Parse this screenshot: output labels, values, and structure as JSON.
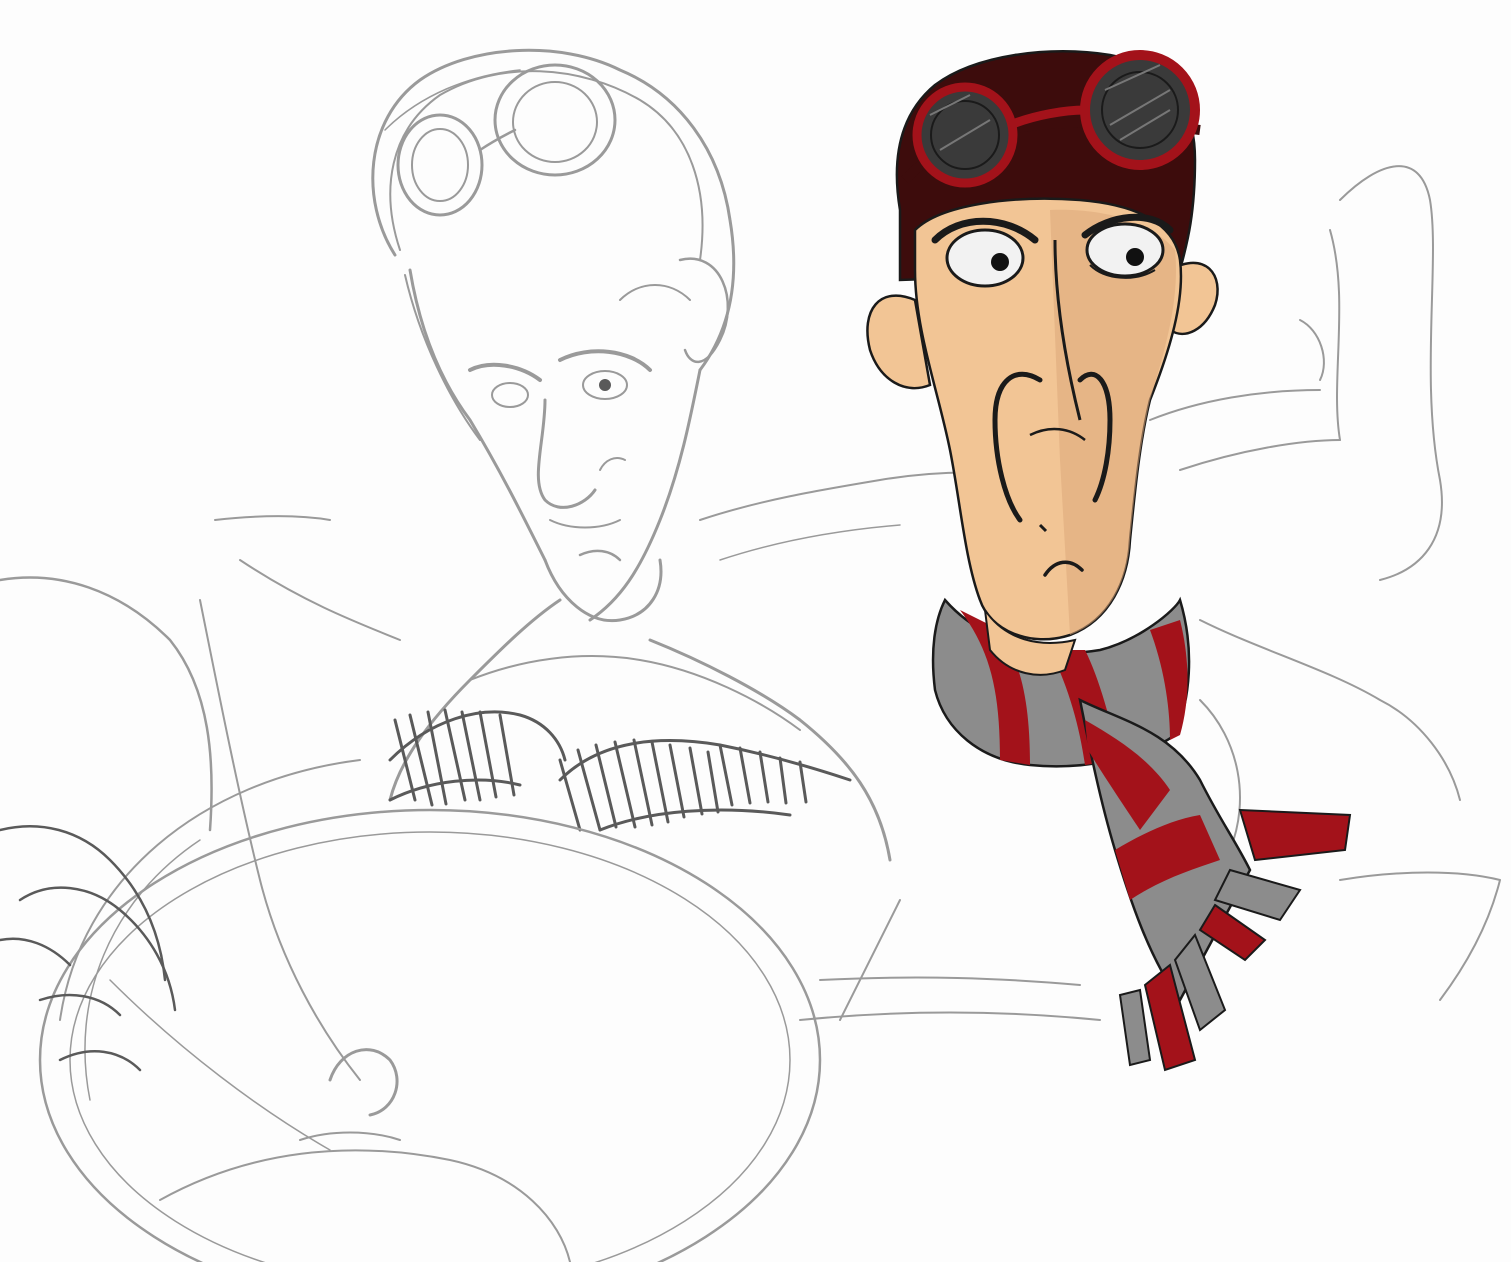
{
  "artwork": {
    "paper_color": "#fdfdfd",
    "pencil_color": "#9a9a9a",
    "pencil_dark": "#5a5a5a",
    "ink_color": "#1a1a1a",
    "skin_color": "#f2c595",
    "skin_shadow": "#dca87a",
    "hair_color": "#3d0c0c",
    "accent_red": "#a3121a",
    "scarf_grey": "#8c8c8c",
    "lens_color": "#3a3a3a"
  },
  "elements": [
    {
      "name": "pencil-sketch-pilot",
      "description_icon": "pencil-sketch-icon"
    },
    {
      "name": "colored-pilot-head",
      "description_icon": "character-portrait-icon"
    },
    {
      "name": "goggles",
      "description_icon": "goggles-icon"
    },
    {
      "name": "striped-scarf",
      "description_icon": "scarf-icon"
    },
    {
      "name": "steering-wheel-sketch",
      "description_icon": "wheel-icon"
    }
  ]
}
